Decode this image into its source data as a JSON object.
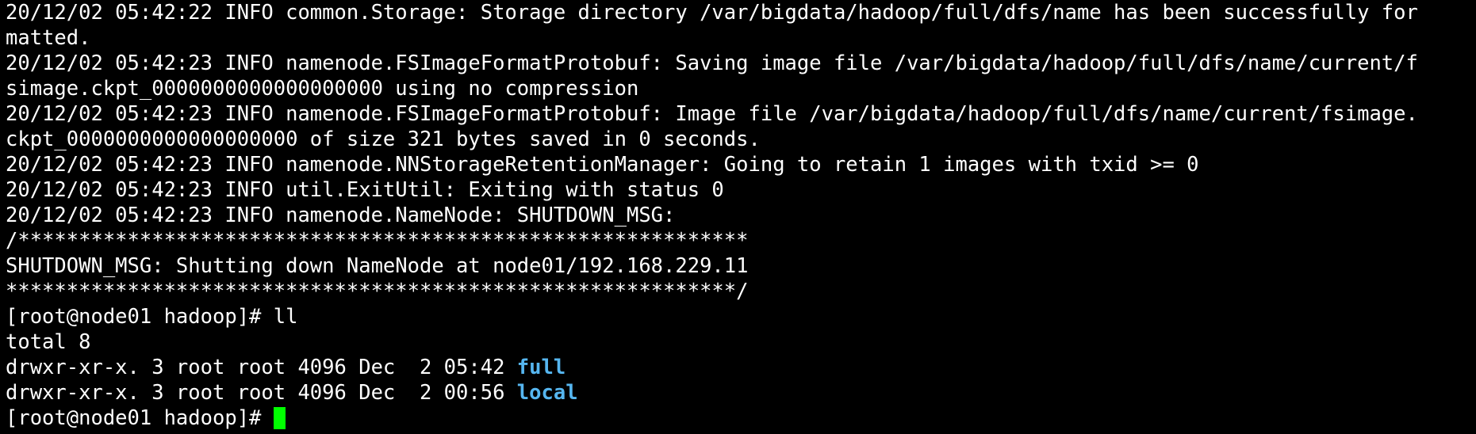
{
  "terminal": {
    "lines": [
      "20/12/02 05:42:22 INFO common.Storage: Storage directory /var/bigdata/hadoop/full/dfs/name has been successfully for",
      "matted.",
      "20/12/02 05:42:23 INFO namenode.FSImageFormatProtobuf: Saving image file /var/bigdata/hadoop/full/dfs/name/current/f",
      "simage.ckpt_0000000000000000000 using no compression",
      "20/12/02 05:42:23 INFO namenode.FSImageFormatProtobuf: Image file /var/bigdata/hadoop/full/dfs/name/current/fsimage.",
      "ckpt_0000000000000000000 of size 321 bytes saved in 0 seconds.",
      "20/12/02 05:42:23 INFO namenode.NNStorageRetentionManager: Going to retain 1 images with txid >= 0",
      "20/12/02 05:42:23 INFO util.ExitUtil: Exiting with status 0",
      "20/12/02 05:42:23 INFO namenode.NameNode: SHUTDOWN_MSG:",
      "/************************************************************",
      "SHUTDOWN_MSG: Shutting down NameNode at node01/192.168.229.11",
      "************************************************************/",
      "[root@node01 hadoop]# ll",
      "total 8"
    ],
    "listing": [
      {
        "prefix": "drwxr-xr-x. 3 root root 4096 Dec  2 05:42 ",
        "name": "full"
      },
      {
        "prefix": "drwxr-xr-x. 3 root root 4096 Dec  2 00:56 ",
        "name": "local"
      }
    ],
    "prompt": "[root@node01 hadoop]# ",
    "colors": {
      "background": "#000000",
      "foreground": "#ffffff",
      "directory": "#56b6f0",
      "cursor": "#00ff00"
    }
  }
}
